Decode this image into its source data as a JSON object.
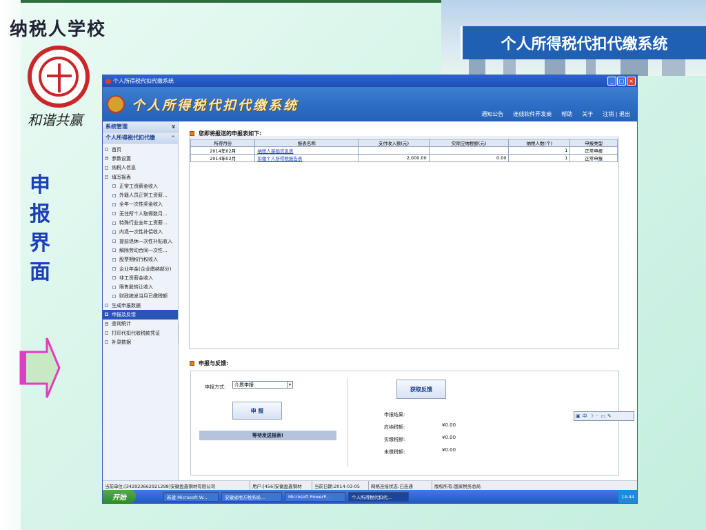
{
  "slide": {
    "title": "个人所得税代扣代缴系统",
    "school_name": "纳税人学校",
    "motto": "和谐共赢",
    "side_label": [
      "申",
      "报",
      "界",
      "面"
    ]
  },
  "window": {
    "title": "个人所得税代扣代缴系统",
    "banner_title": "个人所得税代扣代缴系统",
    "nav": [
      "通知公告",
      "连线软件开发商",
      "帮助",
      "关于",
      "注销 | 退出"
    ],
    "controls": [
      "_",
      "□",
      "×"
    ]
  },
  "sidebar": {
    "header1": "系统管理",
    "header2": "个人所得税代扣代缴",
    "items": [
      {
        "label": "首页",
        "level": 0,
        "box": ""
      },
      {
        "label": "参数设置",
        "level": 0,
        "box": "+"
      },
      {
        "label": "纳税人信息",
        "level": 0,
        "box": ""
      },
      {
        "label": "填写报表",
        "level": 0,
        "box": "-"
      },
      {
        "label": "正常工资薪金收入",
        "level": 1,
        "box": ""
      },
      {
        "label": "外籍人员正常工资薪...",
        "level": 1,
        "box": ""
      },
      {
        "label": "全年一次性奖金收入",
        "level": 1,
        "box": ""
      },
      {
        "label": "无住所个人取得数月...",
        "level": 1,
        "box": ""
      },
      {
        "label": "特殊行业全年工资薪...",
        "level": 1,
        "box": ""
      },
      {
        "label": "内退一次性补偿收入",
        "level": 1,
        "box": ""
      },
      {
        "label": "提前退休一次性补贴收入",
        "level": 1,
        "box": ""
      },
      {
        "label": "解除劳动合同一次性...",
        "level": 1,
        "box": ""
      },
      {
        "label": "股票期权行权收入",
        "level": 1,
        "box": ""
      },
      {
        "label": "企业年金(企业缴纳部分)",
        "level": 1,
        "box": ""
      },
      {
        "label": "非工资薪金收入",
        "level": 1,
        "box": ""
      },
      {
        "label": "限售股转让收入",
        "level": 1,
        "box": ""
      },
      {
        "label": "财政统发当月已缴税额",
        "level": 1,
        "box": ""
      },
      {
        "label": "生成申报数据",
        "level": 0,
        "box": ""
      },
      {
        "label": "申报及反馈",
        "level": 0,
        "box": "",
        "active": true
      },
      {
        "label": "查询统计",
        "level": 0,
        "box": "+"
      },
      {
        "label": "打印代扣代收税款凭证",
        "level": 0,
        "box": ""
      },
      {
        "label": "补录数据",
        "level": 0,
        "box": ""
      }
    ]
  },
  "report_section": {
    "title": "您即将报送的申报表如下:",
    "columns": [
      "所得月份",
      "报表名称",
      "支付收入额(元)",
      "实际应纳税额(元)",
      "纳税人数(个)",
      "申报类型"
    ],
    "rows": [
      [
        "2014年02月",
        "纳税人基础信息表",
        "",
        "",
        "1",
        "正常申报"
      ],
      [
        "2014年02月",
        "扣缴个人所得税报告表",
        "2,000.00",
        "0.00",
        "1",
        "正常申报"
      ]
    ]
  },
  "declare_section": {
    "title": "申报与反馈:",
    "method_label": "申报方式:",
    "method_value": "介质申报",
    "declare_button": "申 报",
    "wait_text": "等待发送报表!",
    "feedback_button": "获取反馈",
    "result_label": "申报结果:",
    "payable_label": "应纳税额:",
    "paid_label": "实缴税额:",
    "unpaid_label": "未缴税额:",
    "payable_value": "¥0.00",
    "paid_value": "¥0.00",
    "unpaid_value": "¥0.00"
  },
  "ime": {
    "text": "中"
  },
  "statusbar": {
    "unit": "当前单位:[342923662921298]安徽盈鑫钢材有限公司",
    "user": "用户:[456]安徽盈鑫钢材",
    "date": "当前日期:2014-03-05",
    "network": "网络连接状态:已连通",
    "copyright": "版权所有:国家税务总局"
  },
  "taskbar": {
    "start": "开始",
    "tasks": [
      "新建 Microsoft W...",
      "安徽省地方税务局...",
      "Microsoft PowerP...",
      "个人所得税代扣代..."
    ],
    "clock": "14:44"
  },
  "colors": {
    "title_bar": "#1f5fb4",
    "side_label": "#1b3fb8",
    "sidebar_active": "#2a55b5"
  }
}
